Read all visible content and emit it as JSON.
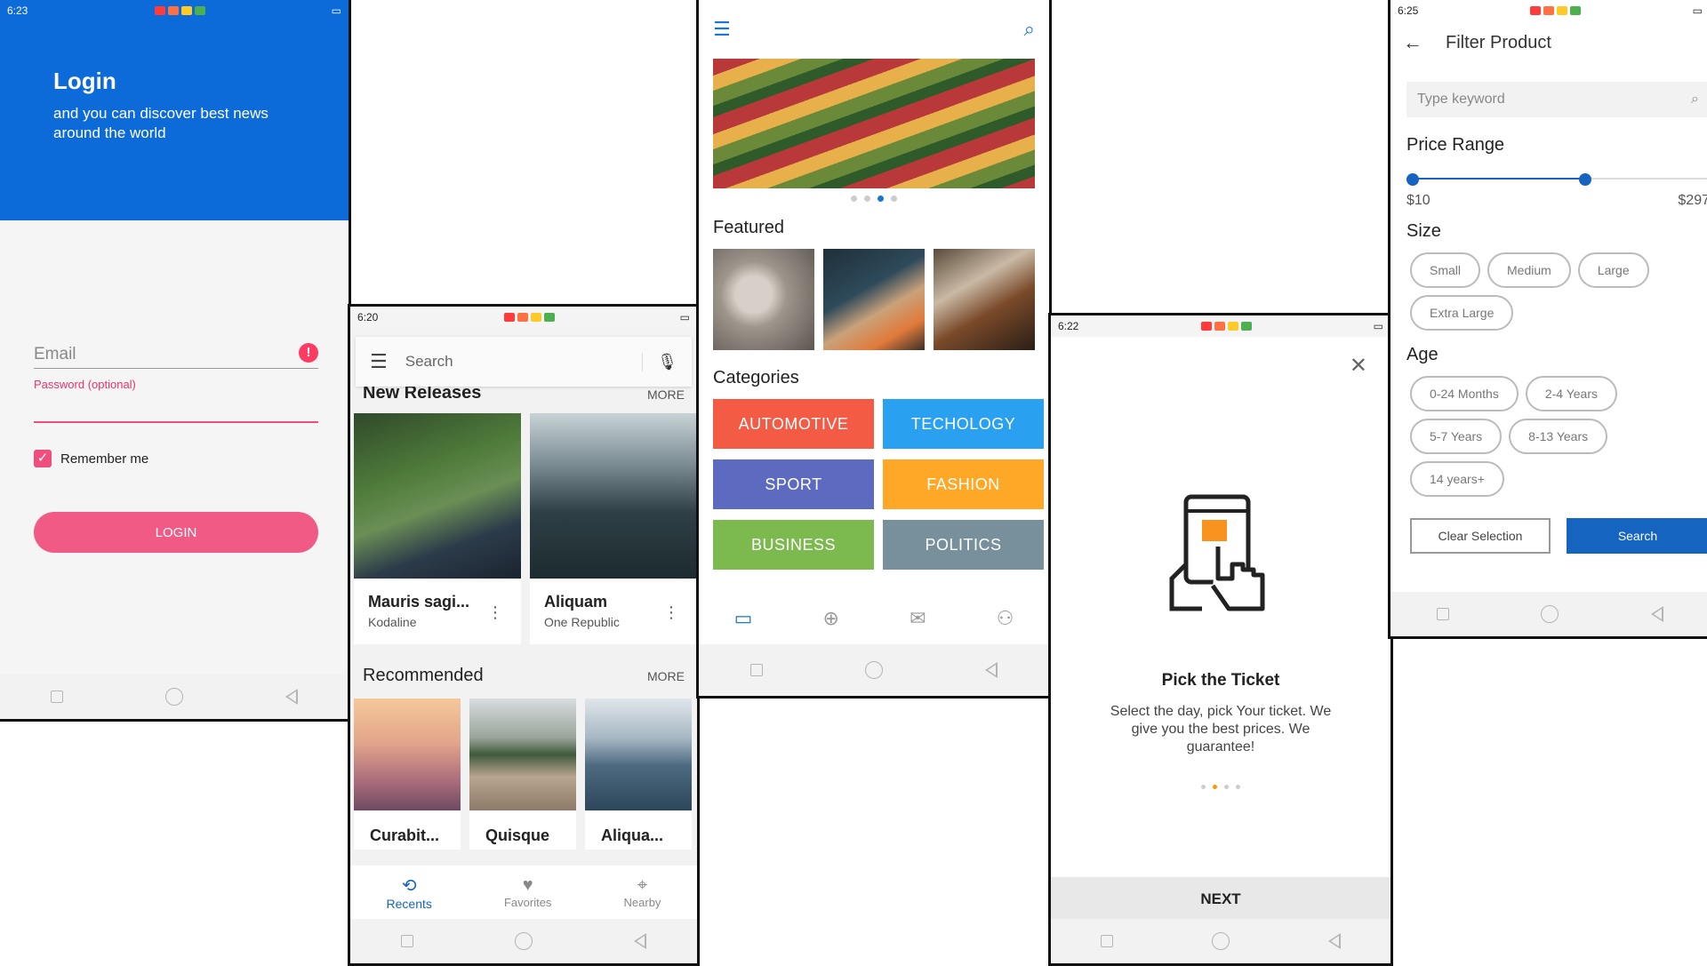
{
  "login": {
    "status_time": "6:23",
    "title": "Login",
    "subtitle": "and you can discover best news around the world",
    "email_placeholder": "Email",
    "password_label": "Password (optional)",
    "remember_label": "Remember me",
    "login_button": "LOGIN"
  },
  "music": {
    "status_time": "6:20",
    "search_placeholder": "Search",
    "new_releases": "New Releases",
    "more1": "MORE",
    "releases": [
      {
        "title": "Mauris sagi...",
        "artist": "Kodaline"
      },
      {
        "title": "Aliquam",
        "artist": "One Republic"
      }
    ],
    "recommended": "Recommended",
    "more2": "MORE",
    "recommended_items": [
      "Curabit...",
      "Quisque",
      "Aliqua..."
    ],
    "tabs": [
      "Recents",
      "Favorites",
      "Nearby"
    ]
  },
  "shop": {
    "featured": "Featured",
    "categories_title": "Categories",
    "categories": [
      {
        "label": "AUTOMOTIVE",
        "color": "#f45b45"
      },
      {
        "label": "TECHOLOGY",
        "color": "#2aa0f0"
      },
      {
        "label": "SPORT",
        "color": "#5c6bc0"
      },
      {
        "label": "FASHION",
        "color": "#ffa726"
      },
      {
        "label": "BUSINESS",
        "color": "#7cb94e"
      },
      {
        "label": "POLITICS",
        "color": "#78909c"
      }
    ]
  },
  "ticket": {
    "status_time": "6:22",
    "title": "Pick the Ticket",
    "text": "Select the day, pick Your ticket. We give you the best prices. We guarantee!",
    "next": "NEXT"
  },
  "filter": {
    "status_time": "6:25",
    "title": "Filter Product",
    "keyword_placeholder": "Type keyword",
    "price_range": "Price Range",
    "min_price": "$10",
    "max_price": "$297",
    "size": "Size",
    "sizes": [
      "Small",
      "Medium",
      "Large",
      "Extra Large"
    ],
    "age": "Age",
    "ages": [
      "0-24 Months",
      "2-4 Years",
      "5-7 Years",
      "8-13 Years",
      "14 years+"
    ],
    "clear_button": "Clear Selection",
    "search_button": "Search"
  }
}
